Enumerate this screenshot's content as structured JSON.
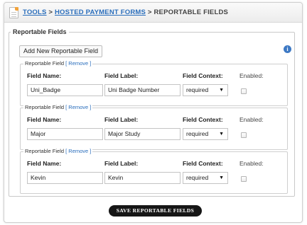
{
  "breadcrumb": {
    "tools": "TOOLS",
    "separator": ">",
    "hosted_payment_forms": "HOSTED PAYMENT FORMS",
    "current": "REPORTABLE FIELDS"
  },
  "section": {
    "legend": "Reportable Fields",
    "add_button": "Add New Reportable Field",
    "info_icon": "i"
  },
  "labels": {
    "field_legend": "Reportable Field",
    "remove": "[ Remove ]",
    "field_name": "Field Name:",
    "field_label": "Field Label:",
    "field_context": "Field Context:",
    "enabled": "Enabled:"
  },
  "fields": [
    {
      "name": "Uni_Badge",
      "label": "Uni Badge Number",
      "context": "required",
      "enabled": false
    },
    {
      "name": "Major",
      "label": "Major Study",
      "context": "required",
      "enabled": false
    },
    {
      "name": "Kevin",
      "label": "Kevin",
      "context": "required",
      "enabled": false
    }
  ],
  "select_arrow": "▼",
  "save_button": "SAVE REPORTABLE FIELDS",
  "colors": {
    "link": "#2a6ebc",
    "save_button_bg": "#161616",
    "info_icon": "#3d79c4",
    "doc_icon_corner": "#f2a23a"
  }
}
